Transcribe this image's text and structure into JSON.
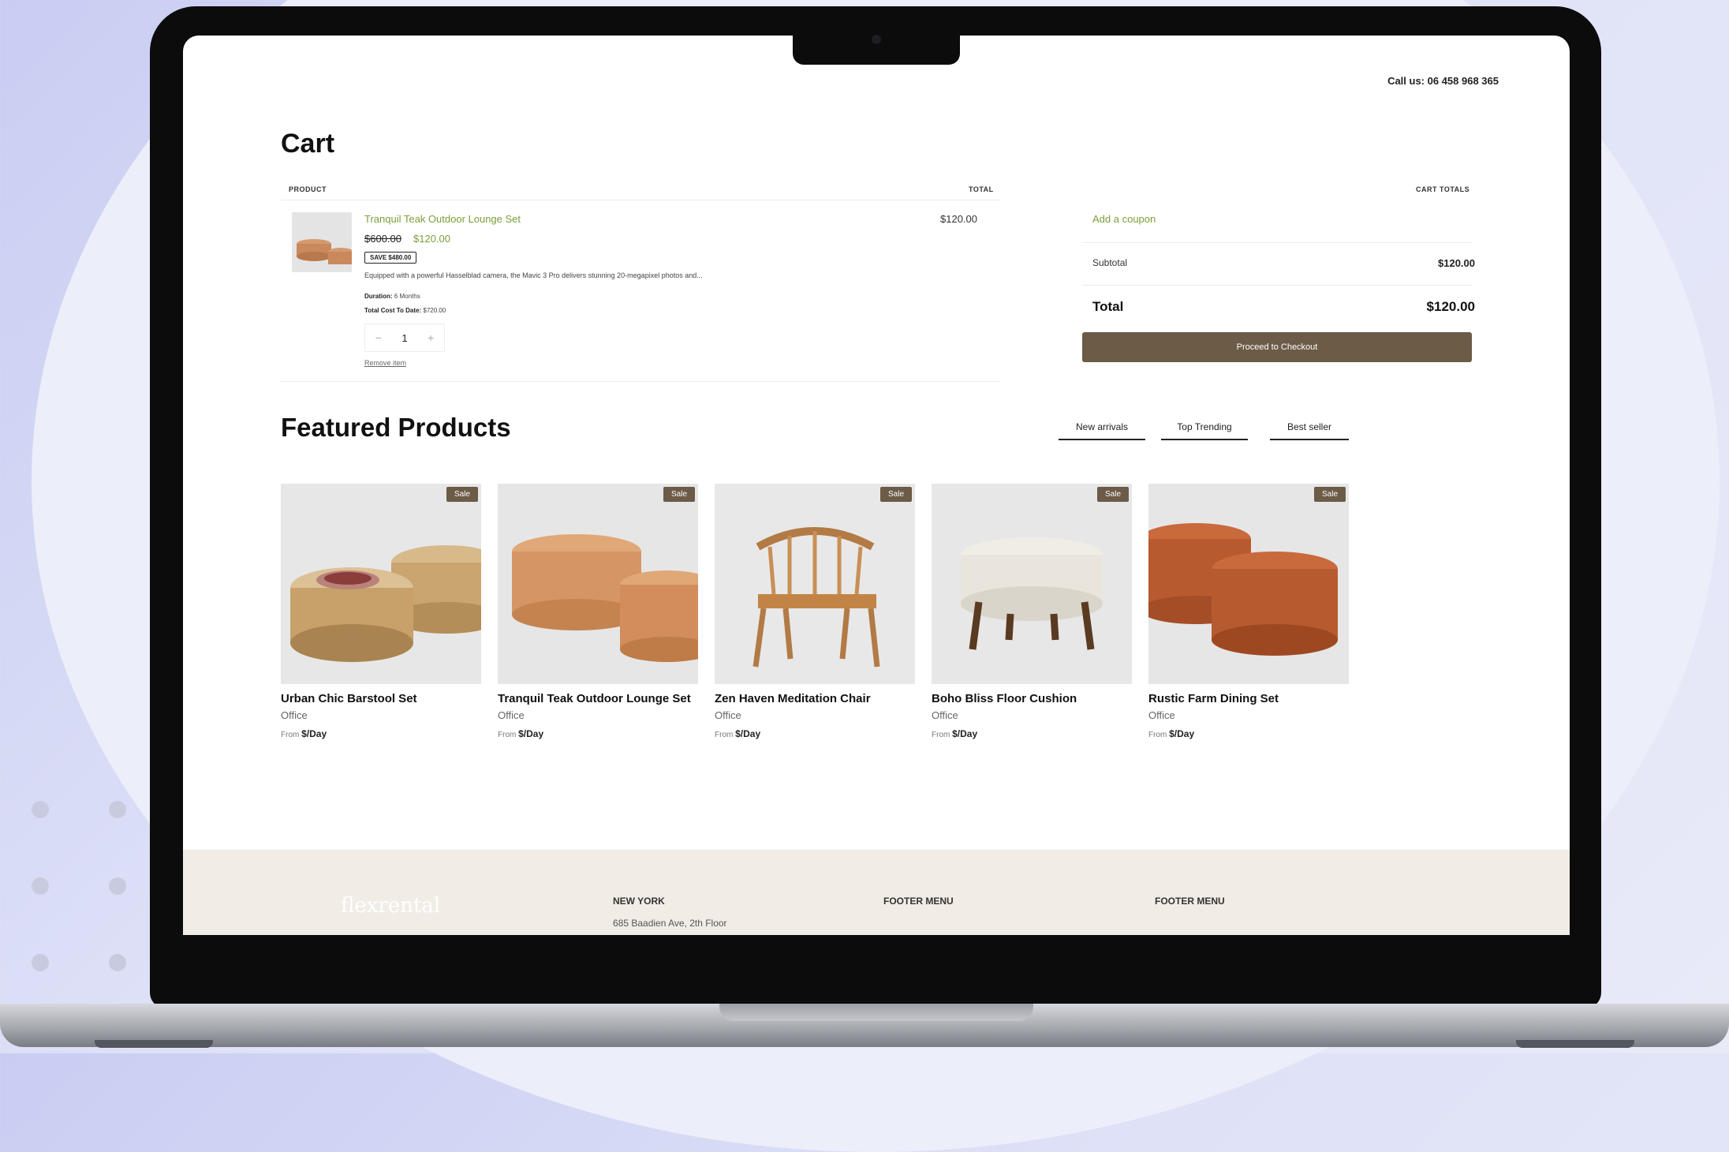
{
  "header": {
    "call_text": "Call us: 06 458 968 365"
  },
  "cart": {
    "title": "Cart",
    "col_product": "PRODUCT",
    "col_total": "TOTAL",
    "item": {
      "name": "Tranquil Teak Outdoor Lounge Set",
      "old_price": "$600.00",
      "new_price": "$120.00",
      "save_badge": "SAVE $480.00",
      "description": "Equipped with a powerful Hasselblad camera, the Mavic 3 Pro delivers stunning 20-megapixel photos and...",
      "duration_label": "Duration:",
      "duration_value": "6 Months",
      "total_cost_label": "Total Cost To Date:",
      "total_cost_value": "$720.00",
      "quantity": "1",
      "minus": "−",
      "plus": "+",
      "remove_label": "Remove item",
      "line_total": "$120.00"
    }
  },
  "totals": {
    "heading": "CART TOTALS",
    "coupon_label": "Add a coupon",
    "subtotal_label": "Subtotal",
    "subtotal_value": "$120.00",
    "total_label": "Total",
    "total_value": "$120.00",
    "checkout_label": "Proceed to Checkout"
  },
  "featured": {
    "title": "Featured Products",
    "tabs": [
      "New arrivals",
      "Top Trending",
      "Best seller"
    ],
    "products": [
      {
        "name": "Urban Chic Barstool Set",
        "category": "Office",
        "price_prefix": "From",
        "price": "$/Day",
        "badge": "Sale"
      },
      {
        "name": "Tranquil Teak Outdoor Lounge Set",
        "category": "Office",
        "price_prefix": "From",
        "price": "$/Day",
        "badge": "Sale"
      },
      {
        "name": "Zen Haven Meditation Chair",
        "category": "Office",
        "price_prefix": "From",
        "price": "$/Day",
        "badge": "Sale"
      },
      {
        "name": "Boho Bliss Floor Cushion",
        "category": "Office",
        "price_prefix": "From",
        "price": "$/Day",
        "badge": "Sale"
      },
      {
        "name": "Rustic Farm Dining Set",
        "category": "Office",
        "price_prefix": "From",
        "price": "$/Day",
        "badge": "Sale"
      }
    ]
  },
  "footer": {
    "logo": "flexrental",
    "col1_title": "NEW YORK",
    "col1_address": "685 Baadien Ave, 2th Floor",
    "col2_title": "FOOTER MENU",
    "col3_title": "FOOTER MENU"
  },
  "colors": {
    "accent": "#6b5b47",
    "link_green": "#7a9e3a",
    "footer_bg": "#f1ece5"
  }
}
